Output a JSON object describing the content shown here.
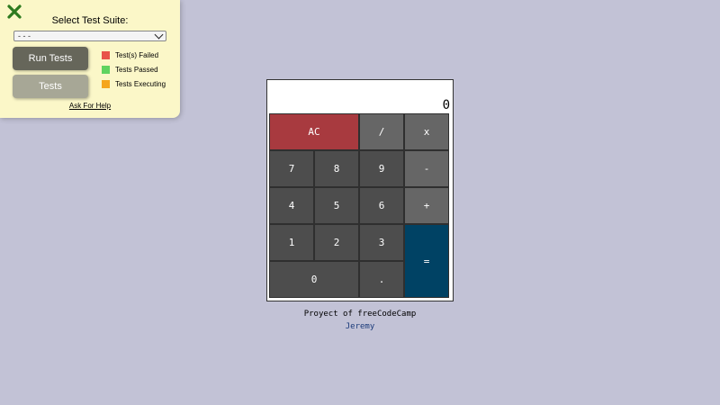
{
  "test_panel": {
    "title": "Select Test Suite:",
    "suite_selected": "- - -",
    "run_button": "Run Tests",
    "tests_button": "Tests",
    "legend": [
      {
        "label": "Test(s) Failed",
        "color": "#e8534a"
      },
      {
        "label": "Tests Passed",
        "color": "#5fd35f"
      },
      {
        "label": "Tests Executing",
        "color": "#f5a61d"
      }
    ],
    "help_link": "Ask For Help",
    "close_icon_color": "#2d7a1f"
  },
  "calculator": {
    "display": "0",
    "keys": {
      "clear": "AC",
      "divide": "/",
      "multiply": "x",
      "seven": "7",
      "eight": "8",
      "nine": "9",
      "subtract": "-",
      "four": "4",
      "five": "5",
      "six": "6",
      "add": "+",
      "one": "1",
      "two": "2",
      "three": "3",
      "equals": "=",
      "zero": "0",
      "decimal": "."
    }
  },
  "footer": {
    "credit": "Proyect of freeCodeCamp",
    "author": "Jeremy"
  }
}
